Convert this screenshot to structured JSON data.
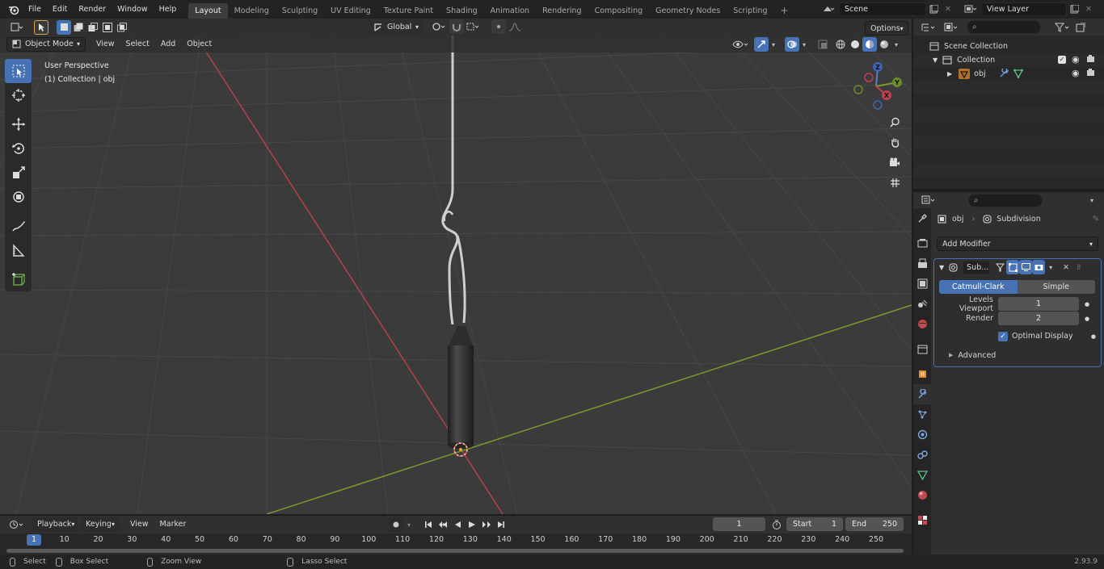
{
  "topbar": {
    "menus": [
      "File",
      "Edit",
      "Render",
      "Window",
      "Help"
    ],
    "workspaces": [
      "Layout",
      "Modeling",
      "Sculpting",
      "UV Editing",
      "Texture Paint",
      "Shading",
      "Animation",
      "Rendering",
      "Compositing",
      "Geometry Nodes",
      "Scripting"
    ],
    "active_workspace": "Layout",
    "scene_name": "Scene",
    "view_layer_name": "View Layer"
  },
  "viewport_header": {
    "mode": "Object Mode",
    "menus": [
      "View",
      "Select",
      "Add",
      "Object"
    ],
    "transform_orientation": "Global",
    "options_label": "Options"
  },
  "viewport": {
    "perspective_label": "User Perspective",
    "collection_label": "(1) Collection | obj",
    "gizmo_axes": {
      "x": "X",
      "y": "Y",
      "z": "Z"
    }
  },
  "outliner": {
    "root": "Scene Collection",
    "collection": "Collection",
    "object": "obj"
  },
  "properties": {
    "breadcrumb_object": "obj",
    "breadcrumb_modifier": "Subdivision",
    "add_modifier_label": "Add Modifier",
    "modifier_name": "Sub...",
    "algorithm_options": [
      "Catmull-Clark",
      "Simple"
    ],
    "active_algorithm": "Catmull-Clark",
    "levels_viewport_label": "Levels Viewport",
    "levels_viewport_value": "1",
    "render_label": "Render",
    "render_value": "2",
    "optimal_display_label": "Optimal Display",
    "optimal_display_checked": true,
    "advanced_label": "Advanced"
  },
  "timeline": {
    "menus": [
      "Playback",
      "Keying",
      "View",
      "Marker"
    ],
    "current_frame": "1",
    "start_label": "Start",
    "start_value": "1",
    "end_label": "End",
    "end_value": "250",
    "ruler_marks": [
      "1",
      "10",
      "20",
      "30",
      "40",
      "50",
      "60",
      "70",
      "80",
      "90",
      "100",
      "110",
      "120",
      "130",
      "140",
      "150",
      "160",
      "170",
      "180",
      "190",
      "200",
      "210",
      "220",
      "230",
      "240",
      "250"
    ]
  },
  "statusbar": {
    "select": "Select",
    "box_select": "Box Select",
    "zoom_view": "Zoom View",
    "lasso_select": "Lasso Select",
    "version": "2.93.9"
  },
  "colors": {
    "accent": "#4772b3",
    "x_axis": "#b3414b",
    "y_axis": "#7b9b2f",
    "bg_viewport": "#3b3b3b"
  }
}
